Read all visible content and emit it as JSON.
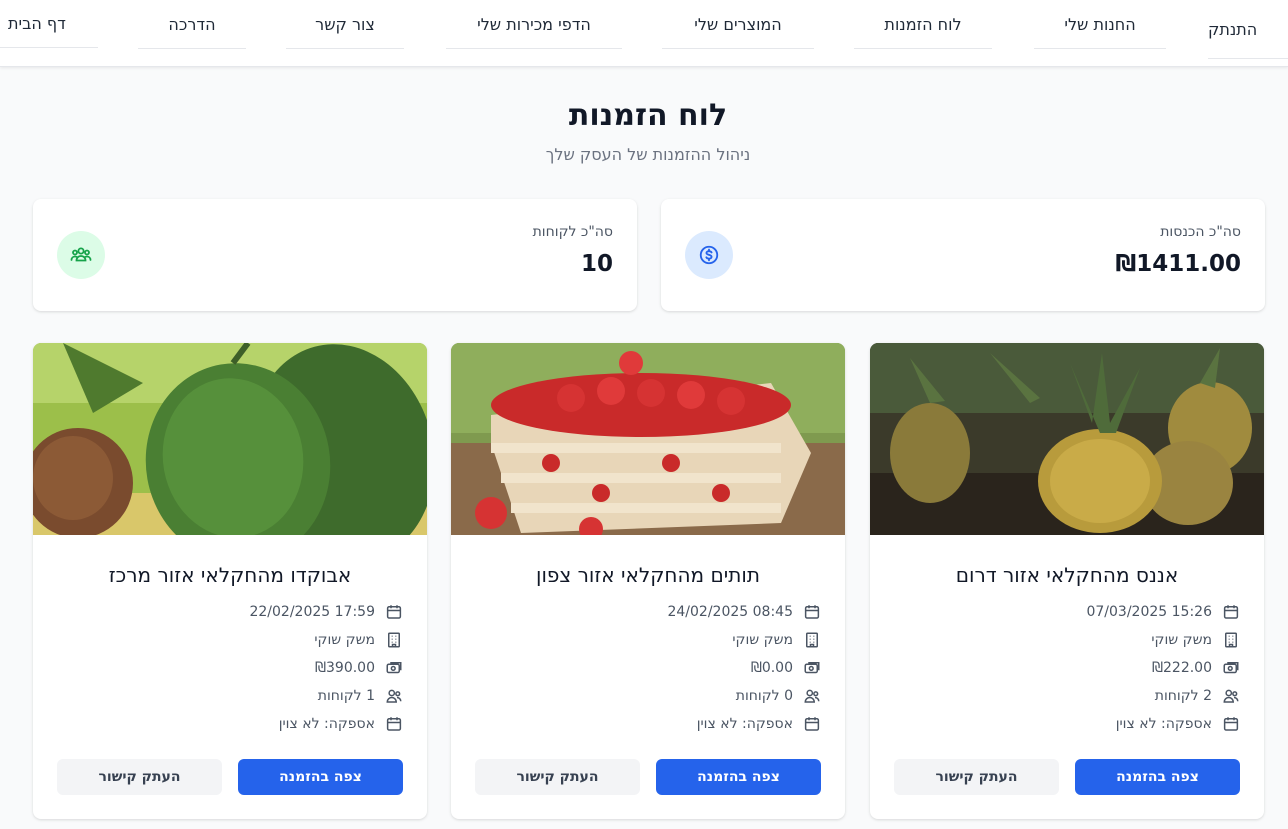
{
  "nav": {
    "logout": "התנתק",
    "my_stores": "החנות שלי",
    "orders_board": "לוח הזמנות",
    "my_products": "המוצרים שלי",
    "my_sales_pages": "הדפי מכירות שלי",
    "contact": "צור קשר",
    "guide": "הדרכה",
    "home": "דף הבית"
  },
  "header": {
    "title": "לוח הזמנות",
    "subtitle": "ניהול ההזמנות של העסק שלך"
  },
  "stats": {
    "revenue_label": "סה\"כ הכנסות",
    "revenue_value": "₪1411.00",
    "customers_label": "סה\"כ לקוחות",
    "customers_value": "10"
  },
  "colors": {
    "primary": "#2563eb",
    "revenue_icon_bg": "#dbeafe",
    "customers_icon_bg": "#dcfce7"
  },
  "products": [
    {
      "title": "אננס מהחקלאי אזור דרום",
      "image": "pineapple-image",
      "date": "15:26 07/03/2025",
      "farm": "משק שוקי",
      "amount": "₪222.00",
      "customers": "2 לקוחות",
      "delivery": "אספקה: לא צוין",
      "view_label": "צפה בהזמנה",
      "copy_label": "העתק קישור"
    },
    {
      "title": "תותים מהחקלאי אזור צפון",
      "image": "strawberries-image",
      "date": "08:45 24/02/2025",
      "farm": "משק שוקי",
      "amount": "₪0.00",
      "customers": "0 לקוחות",
      "delivery": "אספקה: לא צוין",
      "view_label": "צפה בהזמנה",
      "copy_label": "העתק קישור"
    },
    {
      "title": "אבוקדו מהחקלאי אזור מרכז",
      "image": "avocado-image",
      "date": "17:59 22/02/2025",
      "farm": "משק שוקי",
      "amount": "₪390.00",
      "customers": "1 לקוחות",
      "delivery": "אספקה: לא צוין",
      "view_label": "צפה בהזמנה",
      "copy_label": "העתק קישור"
    }
  ]
}
